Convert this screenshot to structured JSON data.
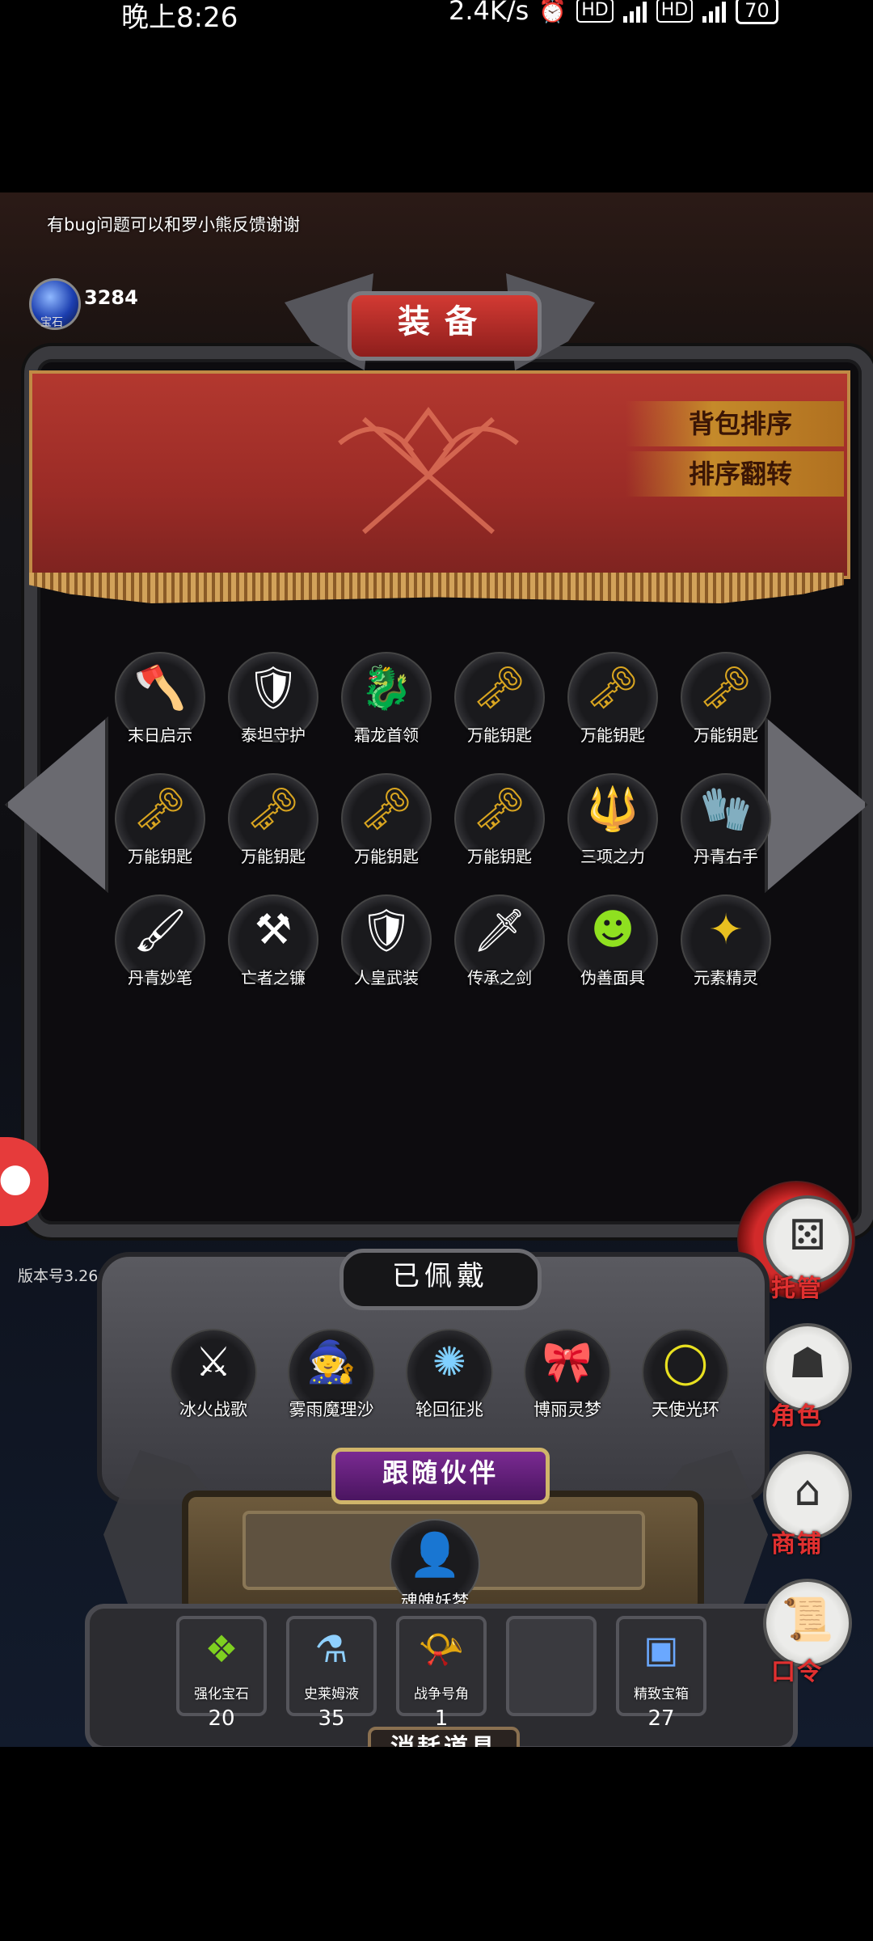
{
  "status_bar": {
    "time": "晚上8:26",
    "speed": "2.4K/s",
    "battery": "70"
  },
  "header": {
    "feedback_text": "有bug问题可以和罗小熊反馈谢谢",
    "gem_label": "宝石",
    "gem_count": "3284",
    "title": "装备",
    "sort_button": "背包排序",
    "reverse_button": "排序翻转"
  },
  "inventory": [
    {
      "label": "末日启示",
      "icon": "halberd-icon"
    },
    {
      "label": "泰坦守护",
      "icon": "titan-armor-icon"
    },
    {
      "label": "霜龙首领",
      "icon": "frost-dragon-icon"
    },
    {
      "label": "万能钥匙",
      "icon": "key-icon"
    },
    {
      "label": "万能钥匙",
      "icon": "key-icon"
    },
    {
      "label": "万能钥匙",
      "icon": "key-icon"
    },
    {
      "label": "万能钥匙",
      "icon": "key-icon"
    },
    {
      "label": "万能钥匙",
      "icon": "key-icon"
    },
    {
      "label": "万能钥匙",
      "icon": "key-icon"
    },
    {
      "label": "万能钥匙",
      "icon": "key-icon"
    },
    {
      "label": "三项之力",
      "icon": "trinity-icon"
    },
    {
      "label": "丹青右手",
      "icon": "glove-icon"
    },
    {
      "label": "丹青妙笔",
      "icon": "brush-icon"
    },
    {
      "label": "亡者之镰",
      "icon": "scythe-icon"
    },
    {
      "label": "人皇武装",
      "icon": "emperor-armor-icon"
    },
    {
      "label": "传承之剑",
      "icon": "sword-icon"
    },
    {
      "label": "伪善面具",
      "icon": "mask-icon"
    },
    {
      "label": "元素精灵",
      "icon": "elemental-icon"
    }
  ],
  "equipped": {
    "title": "已佩戴",
    "items": [
      {
        "label": "冰火战歌",
        "icon": "ice-fire-sword-icon"
      },
      {
        "label": "雾雨魔理沙",
        "icon": "marisa-icon"
      },
      {
        "label": "轮回征兆",
        "icon": "reincarnation-icon"
      },
      {
        "label": "博丽灵梦",
        "icon": "reimu-icon"
      },
      {
        "label": "天使光环",
        "icon": "halo-icon"
      }
    ]
  },
  "companion": {
    "title": "跟随伙伴",
    "name": "魂魄妖梦",
    "icon": "youmu-icon"
  },
  "consumables": {
    "title": "消耗道具",
    "items": [
      {
        "label": "强化宝石",
        "count": "20",
        "icon": "gem-green-icon"
      },
      {
        "label": "史莱姆液",
        "count": "35",
        "icon": "potion-icon"
      },
      {
        "label": "战争号角",
        "count": "1",
        "icon": "horn-icon"
      },
      {
        "label": "",
        "count": "",
        "icon": "empty-slot"
      },
      {
        "label": "精致宝箱",
        "count": "27",
        "icon": "chest-icon"
      }
    ]
  },
  "side": {
    "version": "版本号3.26",
    "buttons": [
      {
        "label": "托管",
        "icon": "dice-icon"
      },
      {
        "label": "角色",
        "icon": "hooded-figure-icon"
      },
      {
        "label": "商铺",
        "icon": "shop-icon"
      },
      {
        "label": "口令",
        "icon": "scroll-icon"
      }
    ]
  }
}
